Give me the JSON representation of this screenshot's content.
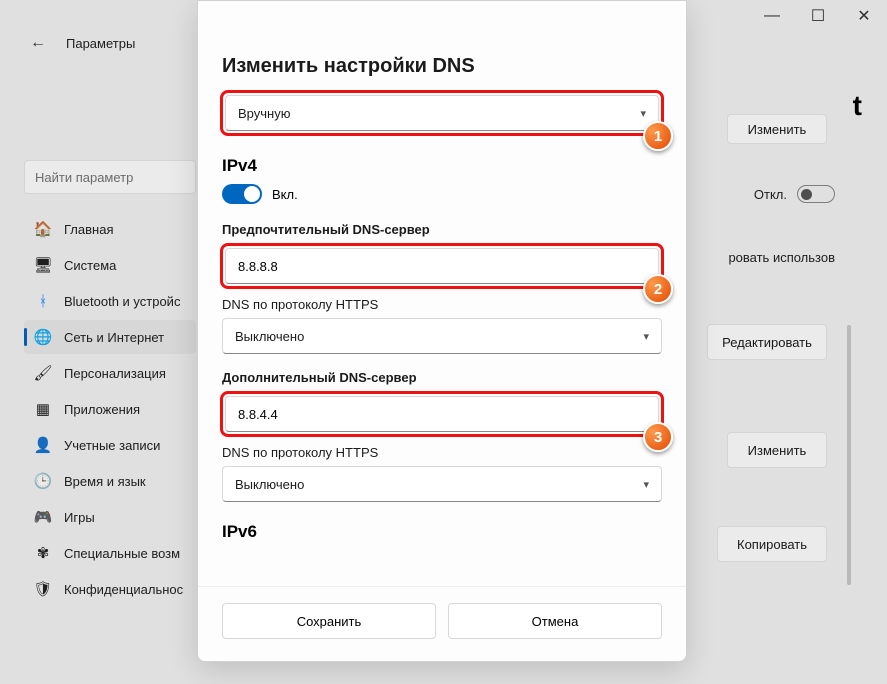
{
  "window": {
    "params": "Параметры",
    "minimize": "—",
    "maximize": "☐",
    "close": "✕"
  },
  "search": {
    "placeholder": "Найти параметр"
  },
  "sidebar": {
    "items": [
      {
        "label": "Главная",
        "icon": "🏠"
      },
      {
        "label": "Система",
        "icon": "🖥"
      },
      {
        "label": "Bluetooth и устройс",
        "icon": "ᚼ"
      },
      {
        "label": "Сеть и Интернет",
        "icon": "🌐"
      },
      {
        "label": "Персонализация",
        "icon": "🖌"
      },
      {
        "label": "Приложения",
        "icon": "▦"
      },
      {
        "label": "Учетные записи",
        "icon": "👤"
      },
      {
        "label": "Время и язык",
        "icon": "🕒"
      },
      {
        "label": "Игры",
        "icon": "🎮"
      },
      {
        "label": "Специальные возм",
        "icon": "✾"
      },
      {
        "label": "Конфиденциальнос",
        "icon": "🛡"
      }
    ]
  },
  "bg": {
    "title_tail": "t",
    "change": "Изменить",
    "off": "Откл.",
    "edit": "Редактировать",
    "change2": "Изменить",
    "copy": "Копировать",
    "use": "ровать использов"
  },
  "dialog": {
    "title": "Изменить настройки DNS",
    "mode": "Вручную",
    "ipv4": "IPv4",
    "on": "Вкл.",
    "preferred_label": "Предпочтительный DNS-сервер",
    "preferred_value": "8.8.8.8",
    "doh_label": "DNS по протоколу HTTPS",
    "doh_value": "Выключено",
    "alt_label": "Дополнительный DNS-сервер",
    "alt_value": "8.8.4.4",
    "ipv6": "IPv6",
    "save": "Сохранить",
    "cancel": "Отмена",
    "c1": "1",
    "c2": "2",
    "c3": "3"
  }
}
